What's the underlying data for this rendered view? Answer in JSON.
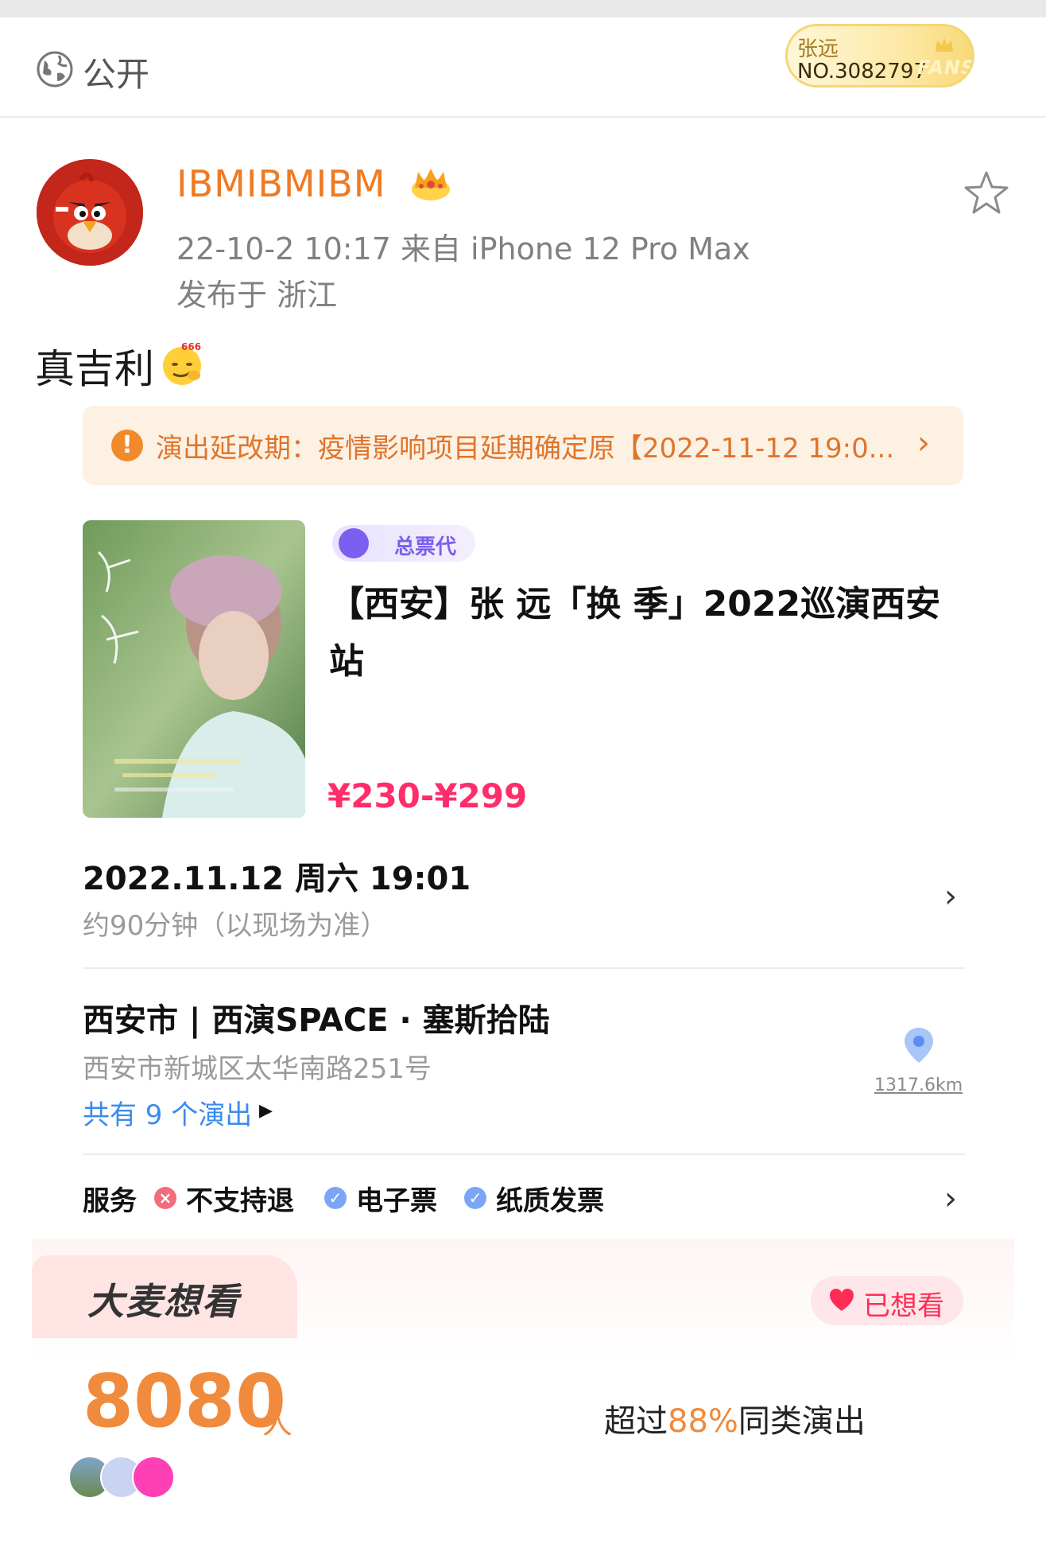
{
  "visibility": {
    "label": "公开"
  },
  "fans_badge": {
    "name": "张远",
    "number": "NO.3082797",
    "word": "FANS"
  },
  "post": {
    "username": "IBMIBMIBM",
    "meta": "22-10-2 10:17   来自 iPhone 12 Pro Max",
    "location": "发布于 浙江",
    "text": "真吉利",
    "emoji_label": "666"
  },
  "notice": {
    "icon": "!",
    "text": "演出延改期：疫情影响项目延期确定原【2022-11-12 19:0...",
    "arrow": "›"
  },
  "event": {
    "tag": "总票代",
    "title": "【西安】张 远「换 季」2022巡演西安站",
    "price": "¥230-¥299",
    "datetime": "2022.11.12 周六 19:01",
    "duration": "约90分钟（以现场为准）",
    "venue": "西安市 | 西演SPACE · 塞斯拾陆",
    "address": "西安市新城区太华南路251号",
    "shows": "共有 9 个演出",
    "distance": "1317.6km"
  },
  "services": {
    "label": "服务",
    "items": [
      {
        "text": "不支持退",
        "icon": "x-icon",
        "color": "#f56b7c"
      },
      {
        "text": "电子票",
        "icon": "check-icon",
        "color": "#7aa6f5"
      },
      {
        "text": "纸质发票",
        "icon": "check-icon",
        "color": "#7aa6f5"
      }
    ]
  },
  "want": {
    "title": "大麦想看",
    "button": "已想看",
    "count": "8080",
    "unit": "人",
    "exceed_prefix": "超过",
    "exceed_pct": "88%",
    "exceed_suffix": "同类演出"
  },
  "colors": {
    "accent_orange": "#f07a22",
    "price_pink": "#ff2d6a",
    "link_blue": "#3a8bf0"
  }
}
